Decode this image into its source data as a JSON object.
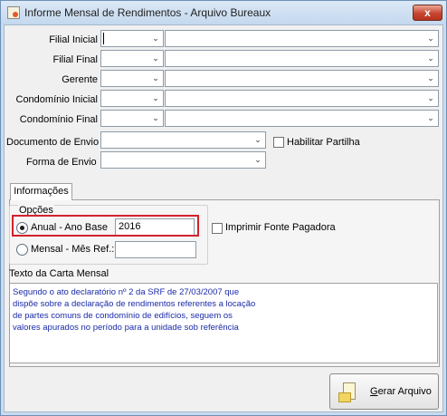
{
  "window": {
    "title": "Informe Mensal de Rendimentos - Arquivo Bureaux",
    "close_label": "x"
  },
  "filters": {
    "filial_inicial": "Filial Inicial",
    "filial_final": "Filial Final",
    "gerente": "Gerente",
    "condominio_inicial": "Condomínio Inicial",
    "condominio_final": "Condomínio Final",
    "documento_envio": "Documento de Envio",
    "forma_envio": "Forma de  Envio",
    "habilitar_partilha": "Habilitar Partilha"
  },
  "tabs": [
    {
      "label": "Informações",
      "active": true
    }
  ],
  "options": {
    "group_label": "Opções",
    "anual_label": "Anual - Ano Base",
    "anual_value": "2016",
    "anual_checked": true,
    "mensal_label": "Mensal - Mês Ref.:",
    "mensal_value": "",
    "imprimir_fonte": "Imprimir Fonte Pagadora"
  },
  "carta": {
    "label": "Texto da Carta Mensal",
    "lines": [
      "Segundo o ato declaratório nº 2 da SRF de 27/03/2007 que",
      "dispõe sobre a declaração de rendimentos referentes a locação",
      "de partes comuns de condomínio de edifícios, seguem os",
      "valores apurados no período para a unidade sob referência"
    ]
  },
  "actions": {
    "gerar_prefix": "G",
    "gerar_rest": "erar Arquivo"
  },
  "colors": {
    "highlight": "#d2222d",
    "memo_text": "#1b2aa8",
    "frame": "#c9dbee"
  }
}
